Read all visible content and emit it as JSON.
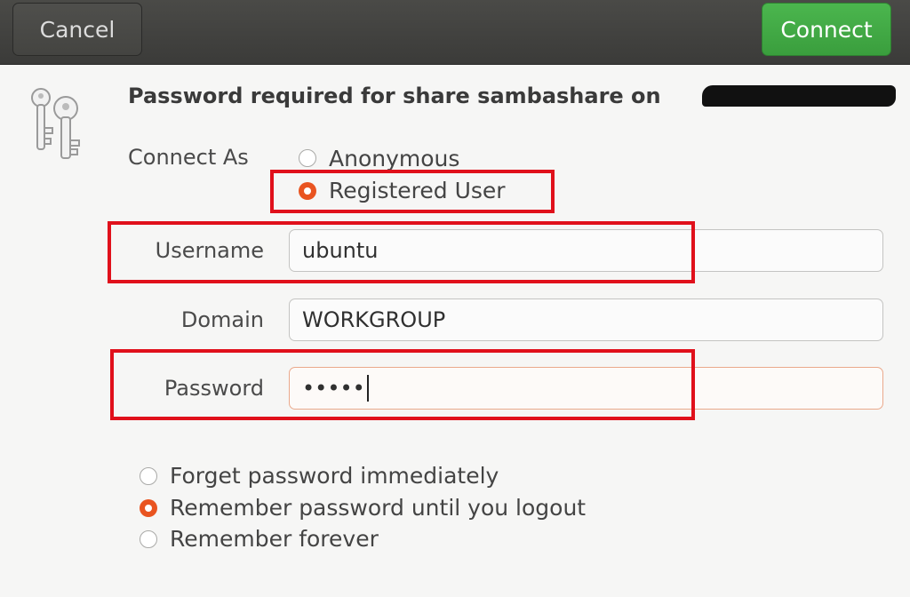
{
  "headerbar": {
    "cancel_label": "Cancel",
    "connect_label": "Connect",
    "connect_color": "#43ab46"
  },
  "dialog": {
    "icon": "keys-icon",
    "title": "Password required for share sambashare on",
    "connect_as": {
      "label": "Connect As",
      "options": [
        "Anonymous",
        "Registered User"
      ],
      "selected": "Registered User"
    },
    "fields": {
      "username": {
        "label": "Username",
        "value": "ubuntu"
      },
      "domain": {
        "label": "Domain",
        "value": "WORKGROUP"
      },
      "password": {
        "label": "Password",
        "value": "•••••"
      }
    },
    "remember": {
      "options": [
        "Forget password immediately",
        "Remember password until you logout",
        "Remember forever"
      ],
      "selected": "Remember password until you logout"
    }
  },
  "accent_color": "#e95420",
  "highlight_color": "#e0101b"
}
